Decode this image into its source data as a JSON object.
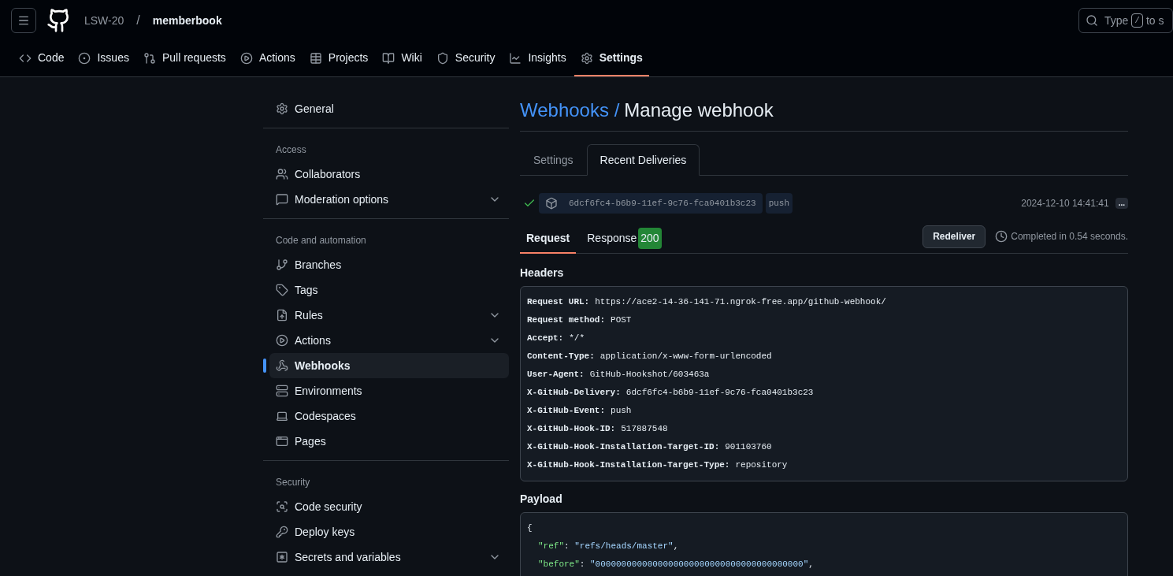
{
  "header": {
    "owner": "LSW-20",
    "separator": "/",
    "repo": "memberbook",
    "search": {
      "placeholder_start": "Type",
      "key": "/",
      "placeholder_end": "to s"
    }
  },
  "repo_nav": [
    {
      "label": "Code",
      "selected": false
    },
    {
      "label": "Issues",
      "selected": false
    },
    {
      "label": "Pull requests",
      "selected": false
    },
    {
      "label": "Actions",
      "selected": false
    },
    {
      "label": "Projects",
      "selected": false
    },
    {
      "label": "Wiki",
      "selected": false
    },
    {
      "label": "Security",
      "selected": false
    },
    {
      "label": "Insights",
      "selected": false
    },
    {
      "label": "Settings",
      "selected": true
    }
  ],
  "sidebar": {
    "groups": [
      {
        "items": [
          {
            "label": "General",
            "selected": false,
            "expandable": false
          }
        ]
      },
      {
        "heading": "Access",
        "items": [
          {
            "label": "Collaborators",
            "selected": false,
            "expandable": false
          },
          {
            "label": "Moderation options",
            "selected": false,
            "expandable": true
          }
        ]
      },
      {
        "heading": "Code and automation",
        "items": [
          {
            "label": "Branches",
            "selected": false,
            "expandable": false
          },
          {
            "label": "Tags",
            "selected": false,
            "expandable": false
          },
          {
            "label": "Rules",
            "selected": false,
            "expandable": true
          },
          {
            "label": "Actions",
            "selected": false,
            "expandable": true
          },
          {
            "label": "Webhooks",
            "selected": true,
            "expandable": false
          },
          {
            "label": "Environments",
            "selected": false,
            "expandable": false
          },
          {
            "label": "Codespaces",
            "selected": false,
            "expandable": false
          },
          {
            "label": "Pages",
            "selected": false,
            "expandable": false
          }
        ]
      },
      {
        "heading": "Security",
        "items": [
          {
            "label": "Code security",
            "selected": false,
            "expandable": false
          },
          {
            "label": "Deploy keys",
            "selected": false,
            "expandable": false
          },
          {
            "label": "Secrets and variables",
            "selected": false,
            "expandable": true
          }
        ]
      }
    ]
  },
  "main": {
    "breadcrumb": "Webhooks /",
    "title": "Manage webhook",
    "tabs": [
      {
        "label": "Settings",
        "selected": false
      },
      {
        "label": "Recent Deliveries",
        "selected": true
      }
    ],
    "delivery": {
      "success": true,
      "guid": "6dcf6fc4-b6b9-11ef-9c76-fca0401b3c23",
      "event": "push",
      "time": "2024-12-10 14:41:41",
      "more": "..."
    },
    "detail_tabs": [
      {
        "label": "Request",
        "selected": true
      },
      {
        "label": "Response",
        "selected": false,
        "badge": "200"
      }
    ],
    "redeliver": "Redeliver",
    "completed": "Completed in 0.54 seconds.",
    "headers_title": "Headers",
    "headers": [
      {
        "name": "Request URL:",
        "value": "https://ace2-14-36-141-71.ngrok-free.app/github-webhook/"
      },
      {
        "name": "Request method:",
        "value": "POST"
      },
      {
        "name": "Accept:",
        "value": "*/*"
      },
      {
        "name": "Content-Type:",
        "value": "application/x-www-form-urlencoded"
      },
      {
        "name": "User-Agent:",
        "value": "GitHub-Hookshot/603463a"
      },
      {
        "name": "X-GitHub-Delivery:",
        "value": "6dcf6fc4-b6b9-11ef-9c76-fca0401b3c23"
      },
      {
        "name": "X-GitHub-Event:",
        "value": "push"
      },
      {
        "name": "X-GitHub-Hook-ID:",
        "value": "517887548"
      },
      {
        "name": "X-GitHub-Hook-Installation-Target-ID:",
        "value": "901103760"
      },
      {
        "name": "X-GitHub-Hook-Installation-Target-Type:",
        "value": "repository"
      }
    ],
    "payload_title": "Payload",
    "payload": [
      {
        "kind": "brace",
        "text": "{"
      },
      {
        "kind": "pair",
        "key": "\"ref\"",
        "sep": ": ",
        "value": "\"refs/heads/master\"",
        "end": ","
      },
      {
        "kind": "pair",
        "key": "\"before\"",
        "sep": ": ",
        "value": "\"0000000000000000000000000000000000000000\"",
        "end": ","
      }
    ]
  }
}
